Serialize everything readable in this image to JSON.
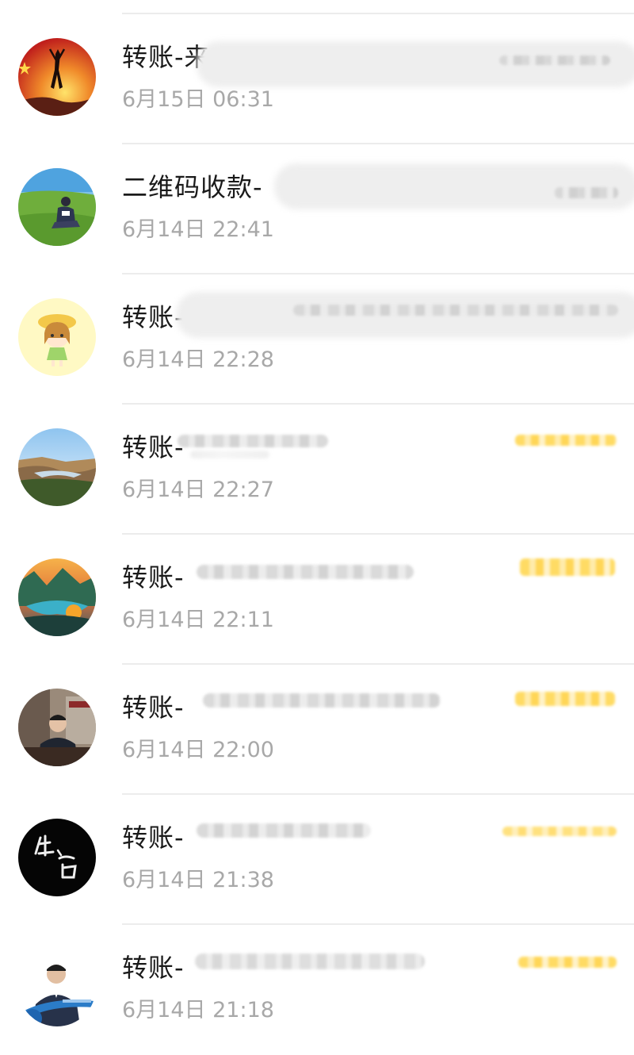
{
  "transactions": [
    {
      "title": "转账-来",
      "time": "6月15日 06:31"
    },
    {
      "title": "二维码收款-",
      "time": "6月14日 22:41"
    },
    {
      "title": "转账-",
      "time": "6月14日 22:28"
    },
    {
      "title": "转账-",
      "time": "6月14日 22:27"
    },
    {
      "title": "转账-",
      "time": "6月14日 22:11"
    },
    {
      "title": "转账-",
      "time": "6月14日 22:00"
    },
    {
      "title": "转账-",
      "time": "6月14日 21:38"
    },
    {
      "title": "转账-",
      "time": "6月14日 21:18"
    }
  ],
  "colors": {
    "title_text": "#1a1a1a",
    "time_text": "#a8a8a8",
    "divider": "#ececec",
    "amount_blur": "#ffd54a"
  },
  "avatars": [
    {
      "icon": "flag-dancer-avatar"
    },
    {
      "icon": "grassland-person-avatar"
    },
    {
      "icon": "cartoon-girl-avatar"
    },
    {
      "icon": "canyon-landscape-avatar"
    },
    {
      "icon": "fantasy-landscape-avatar"
    },
    {
      "icon": "man-in-office-avatar"
    },
    {
      "icon": "calligraphy-avatar"
    },
    {
      "icon": "businessman-avatar"
    }
  ]
}
